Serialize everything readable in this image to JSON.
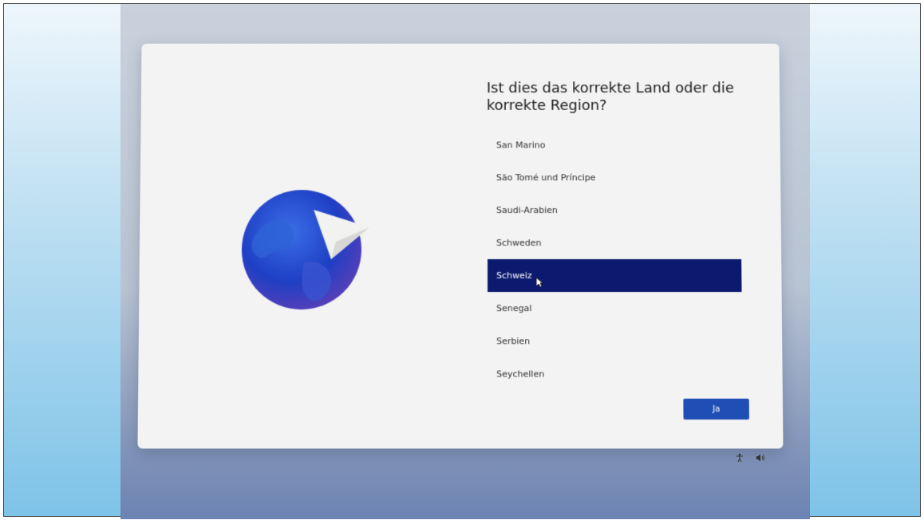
{
  "setup": {
    "title": "Ist dies das korrekte Land oder die korrekte Region?",
    "regions": [
      {
        "label": "San Marino",
        "selected": false
      },
      {
        "label": "São Tomé und Príncipe",
        "selected": false
      },
      {
        "label": "Saudi-Arabien",
        "selected": false
      },
      {
        "label": "Schweden",
        "selected": false
      },
      {
        "label": "Schweiz",
        "selected": true
      },
      {
        "label": "Senegal",
        "selected": false
      },
      {
        "label": "Serbien",
        "selected": false
      },
      {
        "label": "Seychellen",
        "selected": false
      }
    ],
    "confirm_label": "Ja",
    "accent_color": "#1f4fb5",
    "selected_color": "#0b1a6e"
  },
  "taskbar": {
    "icons": [
      "accessibility-icon",
      "volume-icon"
    ]
  }
}
